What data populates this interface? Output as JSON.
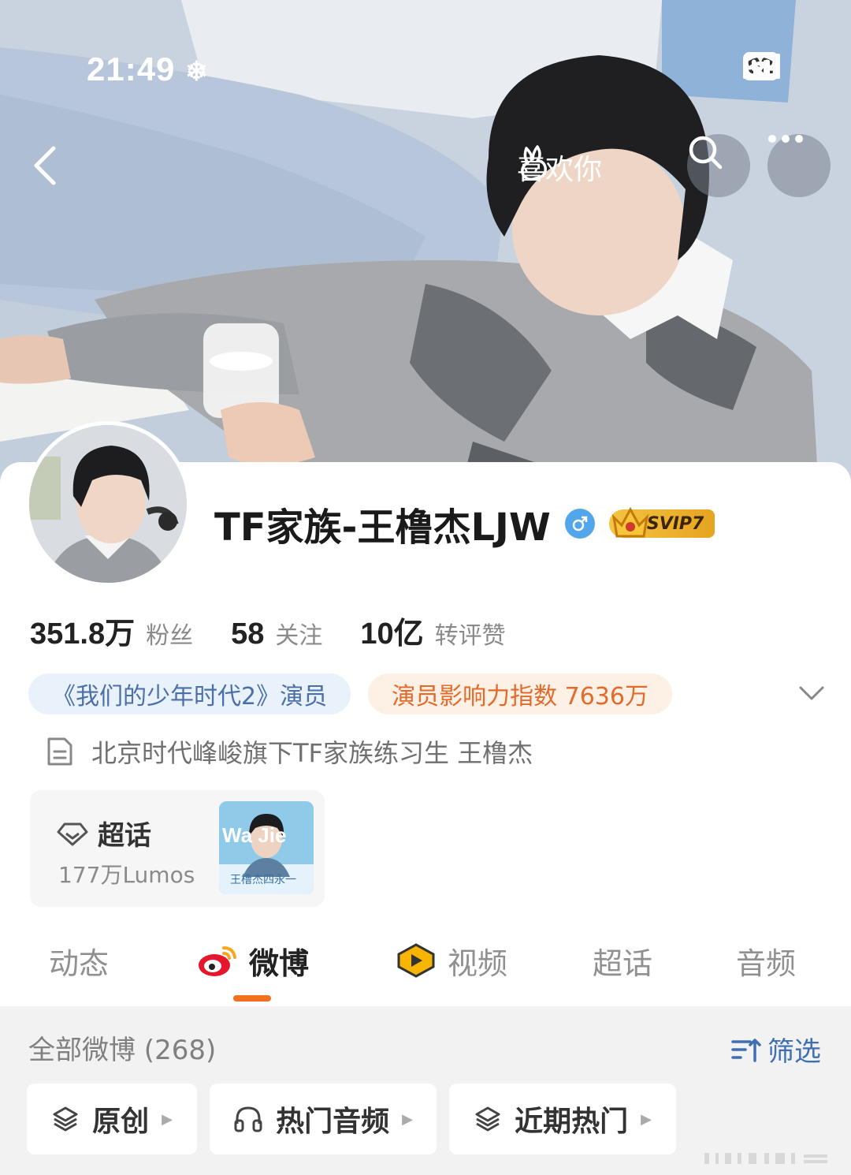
{
  "status_bar": {
    "time": "21:49",
    "battery": "92"
  },
  "nav": {
    "like_label": "喜欢你"
  },
  "profile": {
    "name": "TF家族-王橹杰LJW",
    "vip_badge": "SVIP7",
    "stats": [
      {
        "value": "351.8万",
        "label": "粉丝"
      },
      {
        "value": "58",
        "label": "关注"
      },
      {
        "value": "10亿",
        "label": "转评赞"
      }
    ],
    "tags": [
      "《我们的少年时代2》演员",
      "演员影响力指数 7636万"
    ],
    "bio": "北京时代峰峻旗下TF家族练习生 王橹杰"
  },
  "chaohua": {
    "title": "超话",
    "count": "177万Lumos",
    "thumb_text_top": "Wa  Jie",
    "thumb_text_bottom": "王橹杰四永一"
  },
  "tabs": [
    {
      "label": "动态",
      "active": false
    },
    {
      "label": "微博",
      "active": true
    },
    {
      "label": "视频",
      "active": false
    },
    {
      "label": "超话",
      "active": false
    },
    {
      "label": "音频",
      "active": false
    }
  ],
  "feed": {
    "title": "全部微博 (268)",
    "filter_label": "筛选",
    "chips": [
      "原创",
      "热门音频",
      "近期热门"
    ]
  },
  "colors": {
    "accent": "#f2711c",
    "link_blue": "#3f6fb3",
    "tag_orange": "#e46a2b",
    "tag_blue": "#4b6fa8"
  }
}
